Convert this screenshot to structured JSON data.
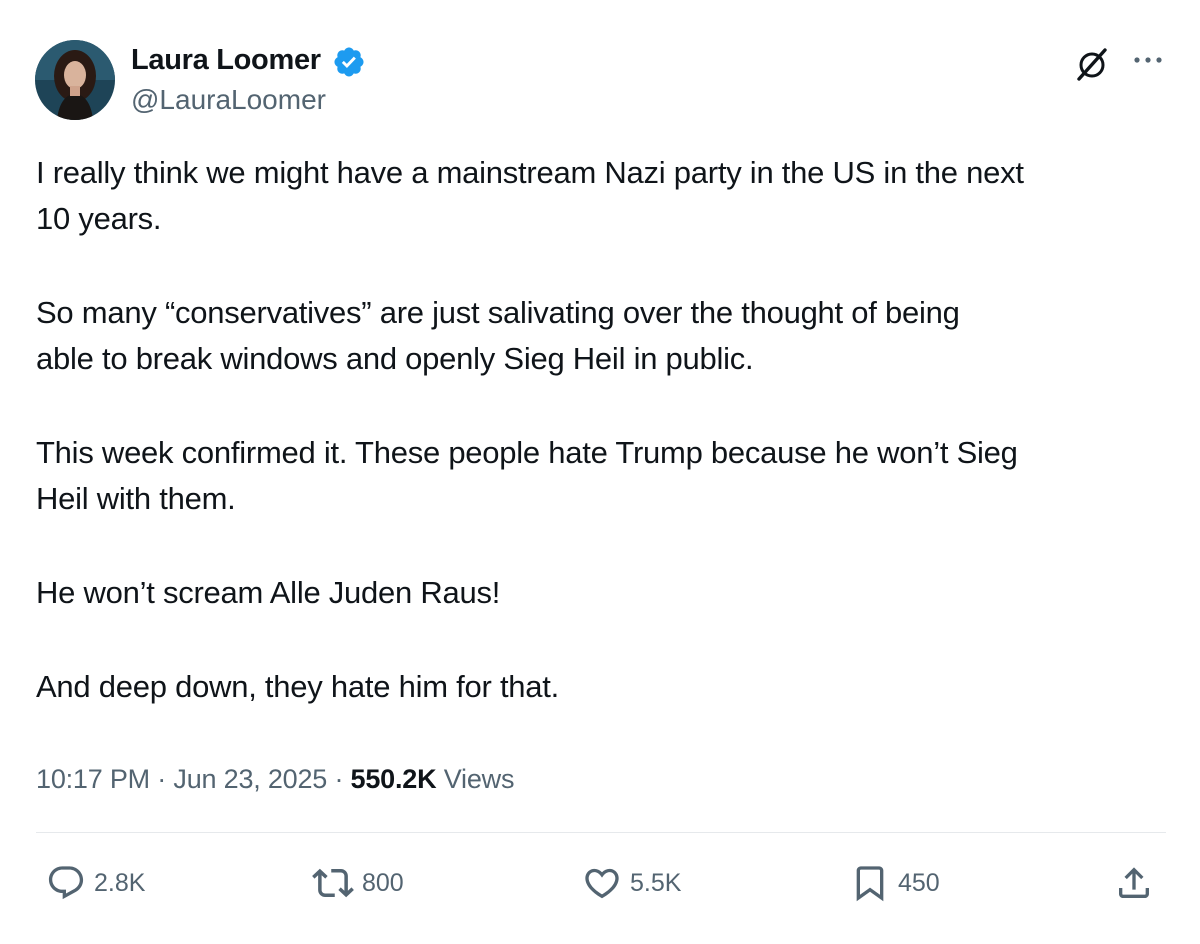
{
  "author": {
    "display_name": "Laura Loomer",
    "handle": "@LauraLoomer",
    "verified": true
  },
  "tweet": {
    "paragraphs": [
      [
        "I really think we might have a mainstream Nazi party in the US in the next",
        "10 years."
      ],
      [
        "So many “conservatives” are just salivating over the thought of being",
        "able to break windows and openly Sieg Heil in public."
      ],
      [
        "This week confirmed it. These people  hate Trump because he won’t Sieg",
        "Heil with them."
      ],
      [
        "He won’t scream Alle Juden Raus!"
      ],
      [
        "And deep down, they hate him for that."
      ]
    ]
  },
  "meta": {
    "time": "10:17 PM",
    "separator": "·",
    "date": "Jun 23, 2025",
    "views_count": "550.2K",
    "views_label": "Views"
  },
  "actions": {
    "reply_count": "2.8K",
    "repost_count": "800",
    "like_count": "5.5K",
    "bookmark_count": "450"
  },
  "icons": {
    "verified": "verified-badge-icon",
    "grok": "grok-icon",
    "more": "more-icon",
    "reply": "reply-icon",
    "repost": "repost-icon",
    "like": "heart-icon",
    "bookmark": "bookmark-icon",
    "share": "share-icon"
  },
  "colors": {
    "verified_blue": "#1d9bf0",
    "text": "#0f1419",
    "secondary": "#536471",
    "divider": "#e6e9ec"
  }
}
